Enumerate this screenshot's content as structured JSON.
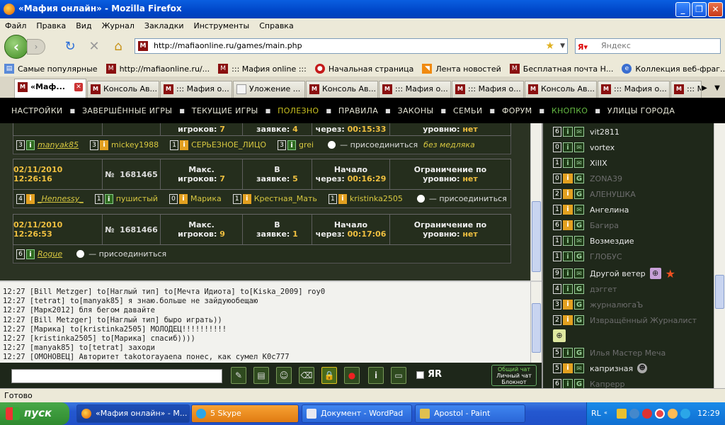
{
  "window": {
    "title": "«Мафия онлайн» - Mozilla Firefox"
  },
  "menu": [
    "Файл",
    "Правка",
    "Вид",
    "Журнал",
    "Закладки",
    "Инструменты",
    "Справка"
  ],
  "nav": {
    "url": "http://mafiaonline.ru/games/main.php",
    "search_placeholder": "Яндекс",
    "search_engine": "Я"
  },
  "bookmarks": [
    "Самые популярные",
    "http://mafiaonline.ru/...",
    "::: Мафия online :::",
    "Начальная страница",
    "Лента новостей",
    "Бесплатная почта Н...",
    "Коллекция веб-фраг..."
  ],
  "tabs": [
    "«Маф...",
    "Консоль Ав...",
    "::: Мафия о...",
    "Уложение ...",
    "Консоль Ав...",
    "::: Мафия о...",
    "::: Мафия о...",
    "Консоль Ав...",
    "::: Мафия о...",
    "::: М"
  ],
  "sitenav": [
    "НАСТРОЙКИ",
    "ЗАВЕРШЁННЫЕ ИГРЫ",
    "ТЕКУЩИЕ ИГРЫ",
    "ПОЛЕЗНО",
    "ПРАВИЛА",
    "ЗАКОНЫ",
    "СЕМЬИ",
    "ФОРУМ",
    "КНОПКО",
    "УЛИЦЫ ГОРОДА"
  ],
  "games": {
    "top_partial": {
      "players_label": "игроков:",
      "players": "7",
      "wait_label": "заявке:",
      "wait": "4",
      "time_label": "через:",
      "time": "00:15:33",
      "level_label": "уровню:",
      "level": "нет"
    },
    "row1": {
      "players": [
        {
          "lvl": "3",
          "role": "i",
          "name": "manyak85"
        },
        {
          "lvl": "3",
          "role": "i",
          "name": "mickey1988"
        },
        {
          "lvl": "1",
          "role": "i",
          "name": "СЕРЬЕЗНОЕ_ЛИЦО"
        },
        {
          "lvl": "3",
          "role": "i",
          "name": "grei"
        }
      ],
      "join": "— присоединиться",
      "mode": "без медляка"
    },
    "g2": {
      "date": "02/11/2010 12:26:16",
      "num_label": "№",
      "num": "1681465",
      "max_label": "Макс.",
      "players_label": "игроков:",
      "players": "7",
      "wait_top": "В",
      "wait_label": "заявке:",
      "wait": "5",
      "start_label": "Начало",
      "time_label": "через:",
      "time": "00:16:29",
      "limit_label": "Ограничение по",
      "level_label": "уровню:",
      "level": "нет"
    },
    "row2": {
      "players": [
        {
          "lvl": "4",
          "role": "i",
          "name": "_Hennessy_"
        },
        {
          "lvl": "1",
          "role": "i",
          "name": "пушистый"
        },
        {
          "lvl": "0",
          "role": "i",
          "name": "Марика"
        },
        {
          "lvl": "1",
          "role": "i",
          "name": "Крестная_Мать"
        },
        {
          "lvl": "1",
          "role": "i",
          "name": "kristinka2505"
        }
      ],
      "join": "— присоединиться"
    },
    "g3": {
      "date": "02/11/2010 12:26:53",
      "num_label": "№",
      "num": "1681466",
      "max_label": "Макс.",
      "players_label": "игроков:",
      "players": "9",
      "wait_top": "В",
      "wait_label": "заявке:",
      "wait": "1",
      "start_label": "Начало",
      "time_label": "через:",
      "time": "00:17:06",
      "limit_label": "Ограничение по",
      "level_label": "уровню:",
      "level": "нет"
    },
    "row3": {
      "players": [
        {
          "lvl": "6",
          "role": "i",
          "name": "Rogue"
        }
      ],
      "join": "— присоединиться"
    }
  },
  "chat": [
    "12:27 [Bill Metzger] to[Наглый тип] to[Мечта Идиота] to[Kiska_2009] roy0",
    "12:27 [tetrat] to[manyak85] я знаю.больше не зайдуюобещаю",
    "12:27 [Марк2012] бля бегом давайте",
    "12:27 [Bill Metzger] to[Наглый тип] быро играть))",
    "12:27 [Марика] to[kristinka2505] МОЛОДЕЦ!!!!!!!!!!",
    "12:27 [kristinka2505] to[Марика] спасиб))))",
    "12:27 [manyak85] to[tetrat] заходи",
    "12:27 [ОМОНОВЕЦ] Авторитет takotorayaena понес, как сумел K0c777"
  ],
  "chatbar": {
    "yar": "ЯR",
    "mode1": "Общий чат",
    "mode2": "Личный чат",
    "mode3": "Блокнот"
  },
  "users": [
    {
      "lvl": "6",
      "role": "i",
      "name": "vit2811",
      "dim": false
    },
    {
      "lvl": "0",
      "role": "i",
      "name": "vortex",
      "dim": false
    },
    {
      "lvl": "1",
      "role": "i",
      "name": "XiIIX",
      "dim": false
    },
    {
      "lvl": "0",
      "role": "G",
      "name": "ZONA39",
      "dim": true
    },
    {
      "lvl": "2",
      "role": "G",
      "name": "АЛЕНУШКА",
      "dim": true
    },
    {
      "lvl": "1",
      "role": "i",
      "name": "Ангелина",
      "dim": false
    },
    {
      "lvl": "6",
      "role": "G",
      "name": "Багира",
      "dim": true
    },
    {
      "lvl": "1",
      "role": "i",
      "name": "Возмездие",
      "dim": false
    },
    {
      "lvl": "1",
      "role": "G",
      "name": "ГЛОБУС",
      "dim": true
    },
    {
      "lvl": "9",
      "role": "i",
      "name": "Другой ветер",
      "dim": false
    },
    {
      "lvl": "4",
      "role": "G",
      "name": "дэггет",
      "dim": true
    },
    {
      "lvl": "3",
      "role": "G",
      "name": "журналюгаЪ",
      "dim": true
    },
    {
      "lvl": "2",
      "role": "G",
      "name": "Извращённый Журналист",
      "dim": true
    },
    {
      "lvl": "5",
      "role": "G",
      "name": "Илья Мастер Меча",
      "dim": true
    },
    {
      "lvl": "5",
      "role": "i",
      "name": "капризная",
      "dim": false
    },
    {
      "lvl": "6",
      "role": "G",
      "name": "Капрерр",
      "dim": true
    }
  ],
  "status": "Готово",
  "taskbar": {
    "start": "пуск",
    "items": [
      "«Мафия онлайн» - М...",
      "5 Skype",
      "Документ - WordPad",
      "Apostol - Paint"
    ],
    "lang": "RL",
    "clock": "12:29"
  }
}
